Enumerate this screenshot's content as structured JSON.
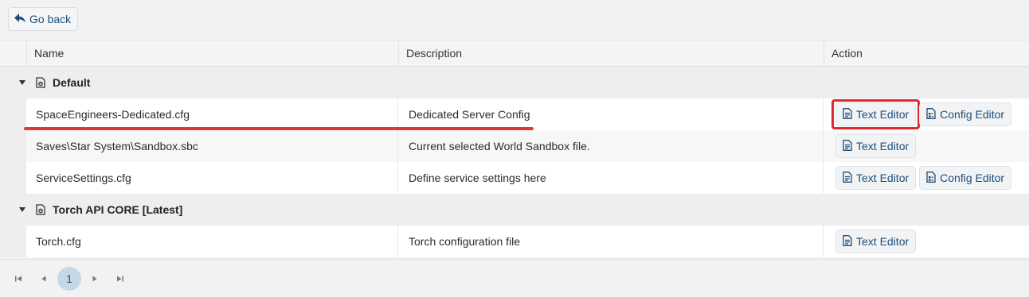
{
  "toolbar": {
    "go_back_label": "Go back"
  },
  "columns": {
    "name": "Name",
    "description": "Description",
    "action": "Action"
  },
  "groups": [
    {
      "label": "Default",
      "rows": [
        {
          "name": "SpaceEngineers-Dedicated.cfg",
          "description": "Dedicated Server Config",
          "actions": [
            "Text Editor",
            "Config Editor"
          ]
        },
        {
          "name": "Saves\\Star System\\Sandbox.sbc",
          "description": "Current selected World Sandbox file.",
          "actions": [
            "Text Editor"
          ]
        },
        {
          "name": "ServiceSettings.cfg",
          "description": "Define service settings here",
          "actions": [
            "Text Editor",
            "Config Editor"
          ]
        }
      ]
    },
    {
      "label": "Torch API CORE [Latest]",
      "rows": [
        {
          "name": "Torch.cfg",
          "description": "Torch configuration file",
          "actions": [
            "Text Editor"
          ]
        }
      ]
    }
  ],
  "pager": {
    "current_page": "1"
  },
  "colors": {
    "accent": "#1f4e79",
    "highlight": "#e0282e",
    "page_active_bg": "#c5d8e8"
  }
}
